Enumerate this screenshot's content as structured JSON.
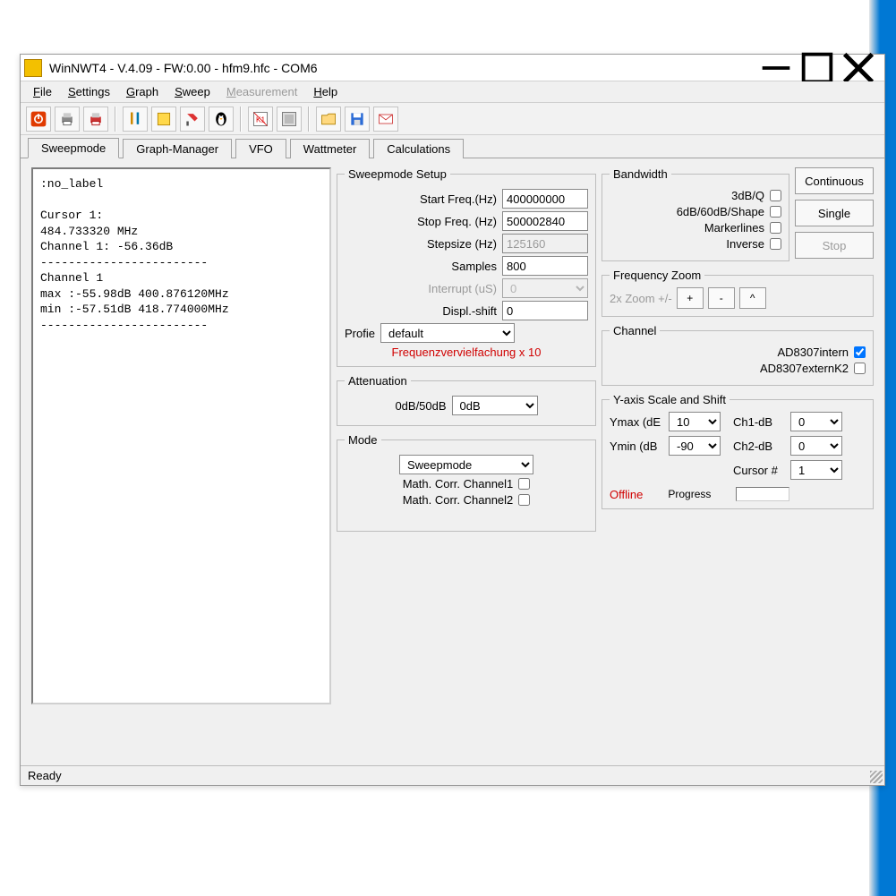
{
  "window": {
    "title": "WinNWT4 - V.4.09 - FW:0.00 - hfm9.hfc - COM6"
  },
  "menubar": {
    "file": "File",
    "settings": "Settings",
    "graph": "Graph",
    "sweep": "Sweep",
    "measurement": "Measurement",
    "help": "Help"
  },
  "tabs": {
    "sweepmode": "Sweepmode",
    "graphmanager": "Graph-Manager",
    "vfo": "VFO",
    "wattmeter": "Wattmeter",
    "calculations": "Calculations"
  },
  "leftpanel_text": ":no_label\n\nCursor 1:\n484.733320 MHz\nChannel 1: -56.36dB\n------------------------\nChannel 1\nmax :-55.98dB 400.876120MHz\nmin :-57.51dB 418.774000MHz\n------------------------",
  "sweepmode_setup": {
    "legend": "Sweepmode Setup",
    "start_freq_label": "Start Freq.(Hz)",
    "start_freq_value": "400000000",
    "stop_freq_label": "Stop Freq. (Hz)",
    "stop_freq_value": "500002840",
    "stepsize_label": "Stepsize (Hz)",
    "stepsize_value": "125160",
    "samples_label": "Samples",
    "samples_value": "800",
    "interrupt_label": "Interrupt (uS)",
    "interrupt_value": "0",
    "displ_shift_label": "Displ.-shift",
    "displ_shift_value": "0",
    "profile_label": "Profie",
    "profile_value": "default",
    "multiplier_note": "Frequenzvervielfachung x 10"
  },
  "attenuation": {
    "legend": "Attenuation",
    "label": "0dB/50dB",
    "value": "0dB"
  },
  "mode": {
    "legend": "Mode",
    "value": "Sweepmode",
    "math_ch1": "Math. Corr. Channel1",
    "math_ch2": "Math. Corr. Channel2"
  },
  "bandwidth": {
    "legend": "Bandwidth",
    "b3db": "3dB/Q",
    "b6db": "6dB/60dB/Shape",
    "markerlines": "Markerlines",
    "inverse": "Inverse"
  },
  "sweep_buttons": {
    "continuous": "Continuous",
    "single": "Single",
    "stop": "Stop"
  },
  "freq_zoom": {
    "legend": "Frequency Zoom",
    "label": "2x Zoom +/-",
    "plus": "+",
    "minus": "-",
    "reset": "^"
  },
  "channel": {
    "legend": "Channel",
    "intern": "AD8307intern",
    "extern": "AD8307externK2"
  },
  "yaxis": {
    "legend": "Y-axis Scale and Shift",
    "ymax_label": "Ymax (dE",
    "ymax_value": "10",
    "ymin_label": "Ymin (dB",
    "ymin_value": "-90",
    "ch1db_label": "Ch1-dB",
    "ch1db_value": "0",
    "ch2db_label": "Ch2-dB",
    "ch2db_value": "0",
    "cursor_label": "Cursor #",
    "cursor_value": "1",
    "offline": "Offline",
    "progress": "Progress"
  },
  "statusbar": "Ready"
}
